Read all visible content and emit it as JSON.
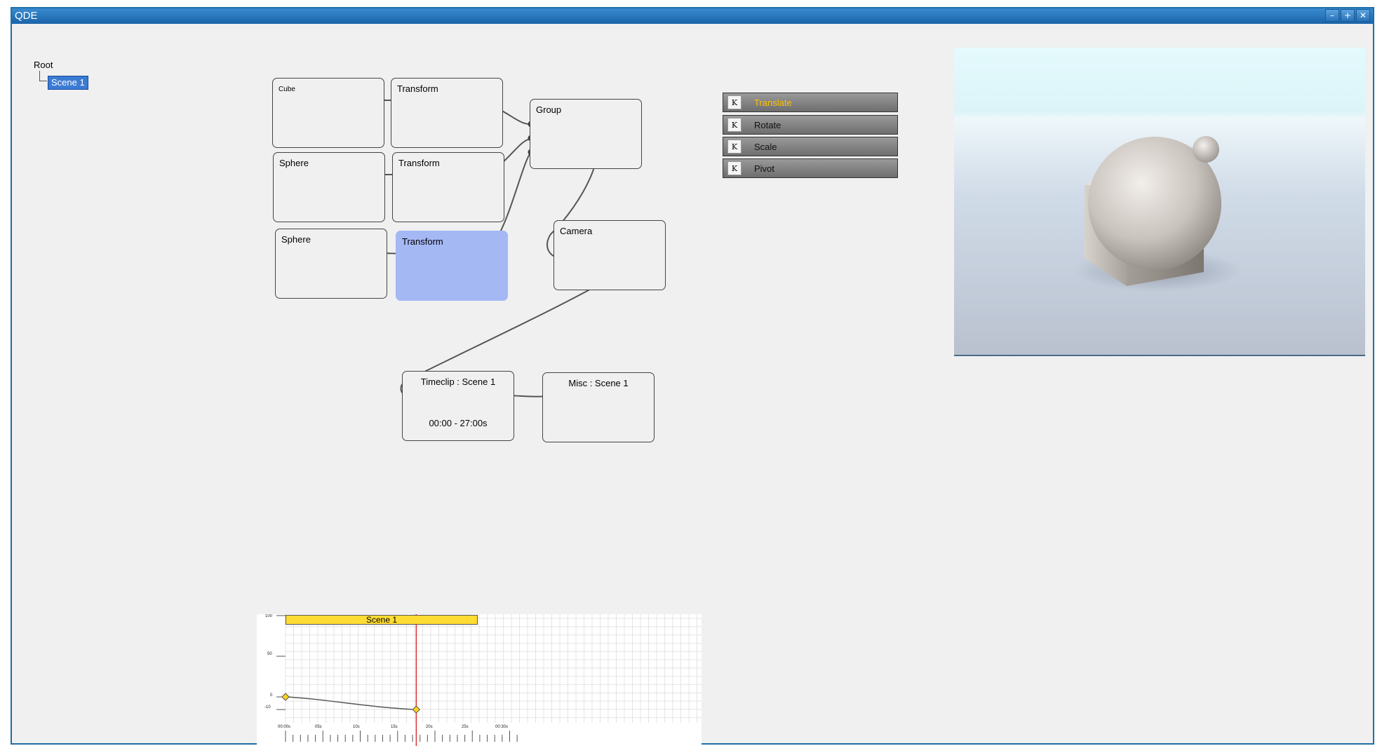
{
  "window": {
    "title": "QDE",
    "buttons": {
      "minimize": "–",
      "maximize": "+",
      "close": "✕"
    }
  },
  "scene_tree": {
    "root": "Root",
    "items": [
      {
        "label": "Scene 1",
        "selected": true
      }
    ]
  },
  "nodes": {
    "cube": "Cube",
    "transform1": "Transform",
    "sphere1": "Sphere",
    "transform2": "Transform",
    "sphere2": "Sphere",
    "transform3": "Transform",
    "group": "Group",
    "camera": "Camera",
    "timeclip": {
      "title": "Timeclip : Scene 1",
      "range": "00:00 - 27:00s"
    },
    "misc": "Misc : Scene 1"
  },
  "tools": [
    {
      "key": "K",
      "label": "Translate",
      "active": true
    },
    {
      "key": "K",
      "label": "Rotate",
      "active": false
    },
    {
      "key": "K",
      "label": "Scale",
      "active": false
    },
    {
      "key": "K",
      "label": "Pivot",
      "active": false
    }
  ],
  "timeline": {
    "clip_label": "Scene 1",
    "y_ticks": [
      "100",
      "50",
      "0",
      "-10"
    ],
    "x_ticks": [
      "00:00s",
      "05s",
      "10s",
      "15s",
      "20s",
      "25s",
      "00:30s"
    ],
    "keyframes": [
      {
        "time_s": 0,
        "value": 0
      },
      {
        "time_s": 17.5,
        "value": -10
      }
    ],
    "playhead_s": 17.5
  },
  "colors": {
    "accent_active": "#ffc000",
    "selected_node": "#a4b8f4",
    "clip_bar": "#ffdc33",
    "playhead": "#e03030",
    "titlebar": "#1f6fa6"
  }
}
